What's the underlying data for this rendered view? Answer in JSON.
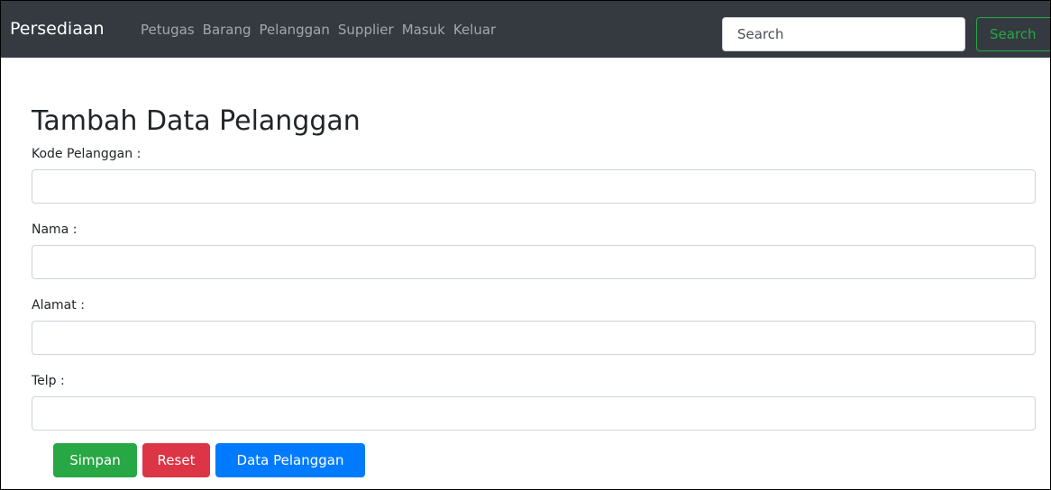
{
  "navbar": {
    "brand": "Persediaan",
    "links": [
      "Petugas",
      "Barang",
      "Pelanggan",
      "Supplier",
      "Masuk",
      "Keluar"
    ],
    "search": {
      "placeholder": "Search",
      "button_label": "Search"
    }
  },
  "form": {
    "title": "Tambah Data Pelanggan",
    "fields": [
      {
        "label": "Kode Pelanggan :",
        "value": ""
      },
      {
        "label": "Nama :",
        "value": ""
      },
      {
        "label": "Alamat :",
        "value": ""
      },
      {
        "label": "Telp :",
        "value": ""
      }
    ],
    "buttons": {
      "save": "Simpan",
      "reset": "Reset",
      "list": "Data Pelanggan"
    }
  },
  "colors": {
    "navbar_bg": "#343a40",
    "success": "#28a745",
    "danger": "#dc3545",
    "primary": "#007bff"
  }
}
